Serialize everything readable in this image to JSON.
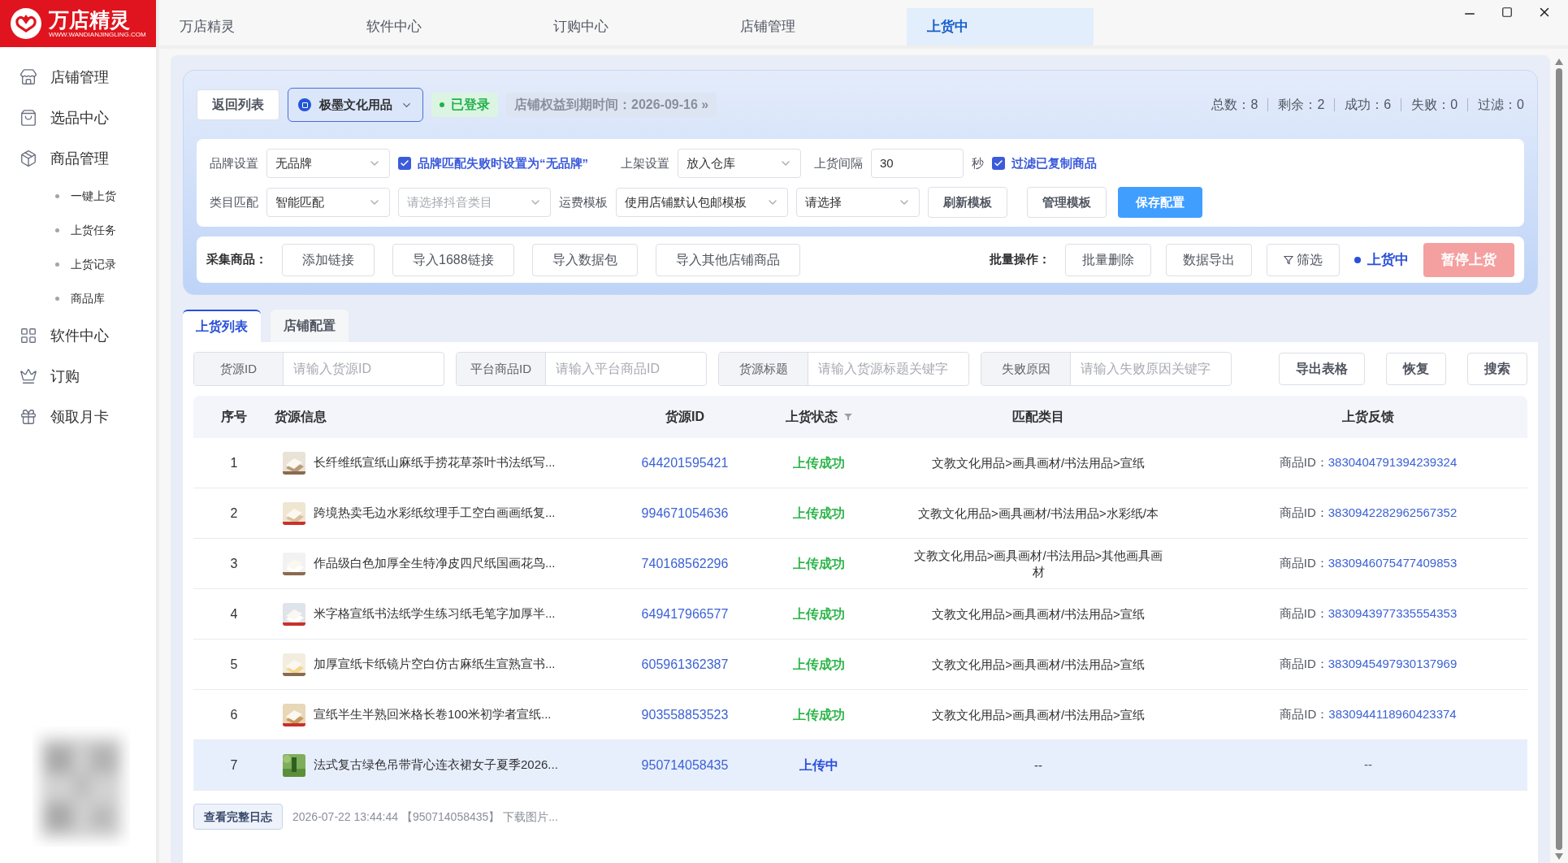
{
  "logo": {
    "title": "万店精灵",
    "subtitle": "WWW.WANDIANJINGLING.COM"
  },
  "top_tabs": [
    {
      "label": "万店精灵",
      "selected": false
    },
    {
      "label": "软件中心",
      "selected": false
    },
    {
      "label": "订购中心",
      "selected": false
    },
    {
      "label": "店铺管理",
      "selected": false
    },
    {
      "label": "上货中",
      "selected": true
    }
  ],
  "sidebar": {
    "items": [
      {
        "label": "店铺管理"
      },
      {
        "label": "选品中心"
      },
      {
        "label": "商品管理",
        "children": [
          {
            "label": "一键上货"
          },
          {
            "label": "上货任务"
          },
          {
            "label": "上货记录"
          },
          {
            "label": "商品库"
          }
        ]
      },
      {
        "label": "软件中心"
      },
      {
        "label": "订购"
      },
      {
        "label": "领取月卡"
      }
    ]
  },
  "header": {
    "back_button": "返回列表",
    "store_select": "极墨文化用品",
    "login_badge": "已登录",
    "expiry": "店铺权益到期时间：2026-09-16 »",
    "stats": [
      "总数：8",
      "剩余：2",
      "成功：6",
      "失败：0",
      "过滤：0"
    ]
  },
  "config": {
    "row1": [
      {
        "kind": "label",
        "text": "品牌设置"
      },
      {
        "kind": "select",
        "value": "无品牌"
      },
      {
        "kind": "checkbox",
        "text": "品牌匹配失败时设置为“无品牌”",
        "checked": true
      },
      {
        "kind": "label",
        "text": "上架设置"
      },
      {
        "kind": "select",
        "value": "放入仓库"
      },
      {
        "kind": "label",
        "text": "上货间隔"
      },
      {
        "kind": "input",
        "value": "30"
      },
      {
        "kind": "label",
        "text": "秒"
      },
      {
        "kind": "checkbox",
        "text": "过滤已复制商品",
        "checked": true
      }
    ],
    "row2": [
      {
        "kind": "label",
        "text": "类目匹配"
      },
      {
        "kind": "select",
        "value": "智能匹配"
      },
      {
        "kind": "select",
        "placeholder": "请选择抖音类目"
      },
      {
        "kind": "label",
        "text": "运费模板"
      },
      {
        "kind": "select",
        "value": "使用店铺默认包邮模板"
      },
      {
        "kind": "select",
        "value": "请选择"
      },
      {
        "kind": "button",
        "text": "刷新模板"
      },
      {
        "kind": "button",
        "text": "管理模板"
      },
      {
        "kind": "primary",
        "text": "保存配置"
      }
    ]
  },
  "collect": {
    "label": "采集商品：",
    "buttons": [
      "添加链接",
      "导入1688链接",
      "导入数据包",
      "导入其他店铺商品"
    ],
    "batch_label": "批量操作：",
    "batch_buttons": [
      {
        "kind": "button",
        "text": "批量删除"
      },
      {
        "kind": "button",
        "text": "数据导出"
      },
      {
        "kind": "filter",
        "text": "筛选"
      }
    ],
    "status": "上货中",
    "pause_button": {
      "text": "暂停上货",
      "disabled": true
    }
  },
  "content_tabs": [
    {
      "label": "上货列表",
      "selected": true
    },
    {
      "label": "店铺配置",
      "selected": false
    }
  ],
  "filters": [
    {
      "label": "货源ID",
      "placeholder": "请输入货源ID"
    },
    {
      "label": "平台商品ID",
      "placeholder": "请输入平台商品ID"
    },
    {
      "label": "货源标题",
      "placeholder": "请输入货源标题关键字"
    },
    {
      "label": "失败原因",
      "placeholder": "请输入失败原因关键字"
    }
  ],
  "filter_buttons": [
    "导出表格",
    "恢复",
    "搜索"
  ],
  "table": {
    "columns": [
      "序号",
      "货源信息",
      "货源ID",
      "上货状态",
      "匹配类目",
      "上货反馈"
    ],
    "rows": [
      {
        "index": "1",
        "title": "长纤维纸宣纸山麻纸手捞花草茶叶书法纸写...",
        "source_id": "644201595421",
        "status": {
          "text": "上传成功",
          "kind": "success"
        },
        "category": "文教文化用品>画具画材/书法用品>宣纸",
        "feedback_label": "商品ID：",
        "product_id": "3830404791394239324",
        "selected": false
      },
      {
        "index": "2",
        "title": "跨境热卖毛边水彩纸纹理手工空白画画纸复...",
        "source_id": "994671054636",
        "status": {
          "text": "上传成功",
          "kind": "success"
        },
        "category": "文教文化用品>画具画材/书法用品>水彩纸/本",
        "feedback_label": "商品ID：",
        "product_id": "3830942282962567352",
        "selected": false
      },
      {
        "index": "3",
        "title": "作品级白色加厚全生特净皮四尺纸国画花鸟...",
        "source_id": "740168562296",
        "status": {
          "text": "上传成功",
          "kind": "success"
        },
        "category": "文教文化用品>画具画材/书法用品>其他画具画材",
        "feedback_label": "商品ID：",
        "product_id": "3830946075477409853",
        "selected": false
      },
      {
        "index": "4",
        "title": "米字格宣纸书法纸学生练习纸毛笔字加厚半...",
        "source_id": "649417966577",
        "status": {
          "text": "上传成功",
          "kind": "success"
        },
        "category": "文教文化用品>画具画材/书法用品>宣纸",
        "feedback_label": "商品ID：",
        "product_id": "3830943977335554353",
        "selected": false
      },
      {
        "index": "5",
        "title": "加厚宣纸卡纸镜片空白仿古麻纸生宣熟宣书...",
        "source_id": "605961362387",
        "status": {
          "text": "上传成功",
          "kind": "success"
        },
        "category": "文教文化用品>画具画材/书法用品>宣纸",
        "feedback_label": "商品ID：",
        "product_id": "3830945497930137969",
        "selected": false
      },
      {
        "index": "6",
        "title": "宣纸半生半熟回米格长卷100米初学者宣纸...",
        "source_id": "903558853523",
        "status": {
          "text": "上传成功",
          "kind": "success"
        },
        "category": "文教文化用品>画具画材/书法用品>宣纸",
        "feedback_label": "商品ID：",
        "product_id": "3830944118960423374",
        "selected": false
      },
      {
        "index": "7",
        "title": "法式复古绿色吊带背心连衣裙女子夏季2026...",
        "source_id": "950714058435",
        "status": {
          "text": "上传中",
          "kind": "uploading"
        },
        "category": "--",
        "feedback": "--",
        "selected": true
      }
    ]
  },
  "footer": {
    "log_button": "查看完整日志",
    "log_text": "2026-07-22 13:44:44 【950714058435】 下载图片..."
  }
}
